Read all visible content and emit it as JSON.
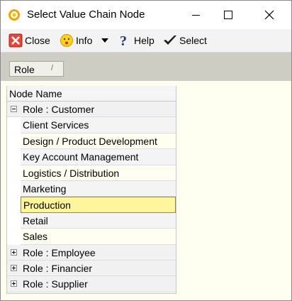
{
  "window": {
    "title": "Select Value Chain Node",
    "app_icon": "value-chain-icon"
  },
  "toolbar": {
    "close_label": "Close",
    "info_label": "Info",
    "help_label": "Help",
    "select_label": "Select"
  },
  "groupbar": {
    "group_label": "Role",
    "sort_glyph": "/"
  },
  "tree": {
    "header": "Node Name",
    "groups": [
      {
        "label": "Role : Customer",
        "expanded": true,
        "children": [
          "Client Services",
          "Design / Product Development",
          "Key Account Management",
          "Logistics / Distribution",
          "Marketing",
          "Production",
          "Retail",
          "Sales"
        ]
      },
      {
        "label": "Role : Employee",
        "expanded": false
      },
      {
        "label": "Role : Financier",
        "expanded": false
      },
      {
        "label": "Role : Supplier",
        "expanded": false
      }
    ],
    "selected": "Production"
  },
  "colors": {
    "selected_row": "#fff59a",
    "group_bar": "#cfccc3",
    "grid_background": "#fffef0"
  }
}
